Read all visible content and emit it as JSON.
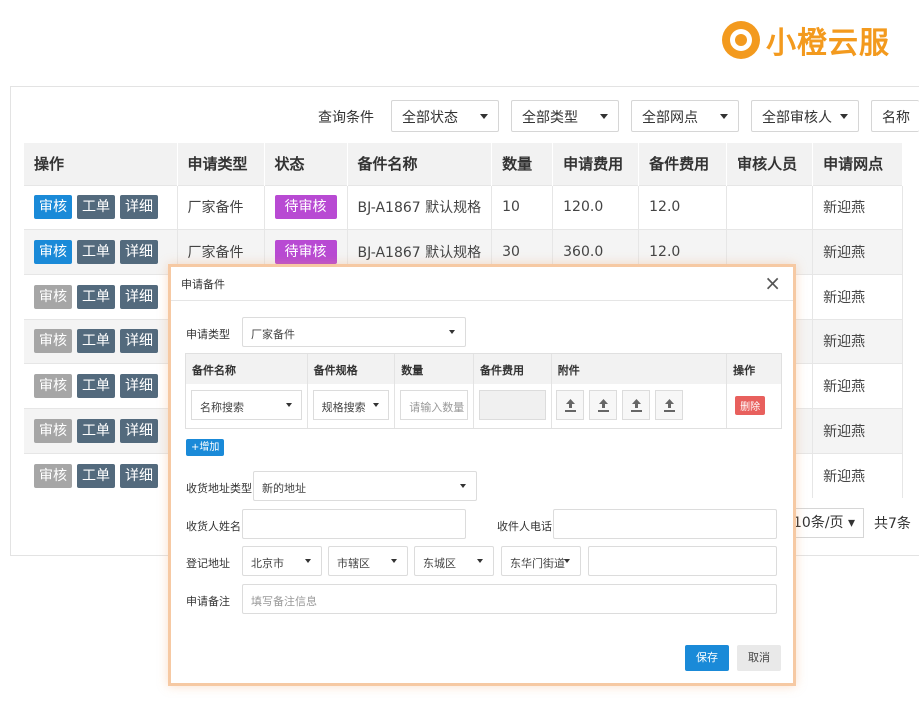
{
  "brand": {
    "logo_text": "小橙云服",
    "color": "#f39a1e"
  },
  "filters": {
    "label": "查询条件",
    "status": "全部状态",
    "type": "全部类型",
    "outlet": "全部网点",
    "reviewer": "全部审核人",
    "name_partial": "名称"
  },
  "table": {
    "headers": [
      "操作",
      "申请类型",
      "状态",
      "备件名称",
      "数量",
      "申请费用",
      "备件费用",
      "审核人员",
      "申请网点"
    ],
    "action_labels": {
      "review": "审核",
      "workorder": "工单",
      "detail": "详细"
    },
    "rows": [
      {
        "type": "厂家备件",
        "status": "待审核",
        "part": "BJ-A1867 默认规格",
        "qty": "10",
        "apply_fee": "120.0",
        "part_fee": "12.0",
        "reviewer": "",
        "outlet": "新迎燕"
      },
      {
        "type": "厂家备件",
        "status": "待审核",
        "part": "BJ-A1867 默认规格",
        "qty": "30",
        "apply_fee": "360.0",
        "part_fee": "12.0",
        "reviewer": "",
        "outlet": "新迎燕"
      },
      {
        "type": "",
        "status": "",
        "part": "",
        "qty": "",
        "apply_fee": "",
        "part_fee": "",
        "reviewer": "",
        "outlet": "新迎燕"
      },
      {
        "type": "",
        "status": "",
        "part": "",
        "qty": "",
        "apply_fee": "",
        "part_fee": "",
        "reviewer": "",
        "outlet": "新迎燕"
      },
      {
        "type": "",
        "status": "",
        "part": "",
        "qty": "",
        "apply_fee": "",
        "part_fee": "",
        "reviewer": "",
        "outlet": "新迎燕"
      },
      {
        "type": "",
        "status": "",
        "part": "",
        "qty": "",
        "apply_fee": "",
        "part_fee": "",
        "reviewer": "",
        "outlet": "新迎燕"
      },
      {
        "type": "",
        "status": "",
        "part": "",
        "qty": "",
        "apply_fee": "",
        "part_fee": "",
        "reviewer": "",
        "outlet": "新迎燕"
      }
    ]
  },
  "pager": {
    "page_size": "10条/页",
    "total": "共7条"
  },
  "modal": {
    "title": "申请备件",
    "close": "×",
    "apply_type_label": "申请类型",
    "apply_type_value": "厂家备件",
    "parts_headers": [
      "备件名称",
      "备件规格",
      "数量",
      "备件费用",
      "附件",
      "操作"
    ],
    "name_search": "名称搜索",
    "spec_search": "规格搜索",
    "qty_placeholder": "请输入数量",
    "delete_label": "删除",
    "add_label": "+增加",
    "address_type_label": "收货地址类型",
    "address_type_value": "新的地址",
    "receiver_name_label": "收货人姓名",
    "receiver_phone_label": "收件人电话",
    "reg_address_label": "登记地址",
    "province": "北京市",
    "city": "市辖区",
    "district": "东城区",
    "street": "东华门街道",
    "remark_label": "申请备注",
    "remark_placeholder": "填写备注信息",
    "save_label": "保存",
    "cancel_label": "取消"
  }
}
